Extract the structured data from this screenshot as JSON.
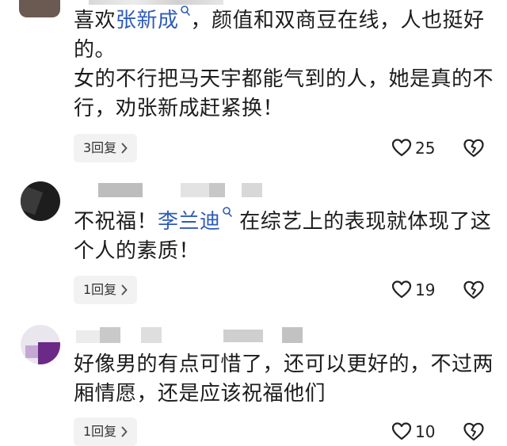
{
  "comments": [
    {
      "line1_pre": "喜欢",
      "mention": "张新成",
      "line1_post": "，颜值和双商豆在线，人也挺好",
      "line2": "的。",
      "line3": "女的不行把马天宇都能气到的人，她是真的不",
      "line4": "行，劝张新成赶紧换！",
      "reply_label": "3回复",
      "likes": "25"
    },
    {
      "line1_pre": "不祝福！",
      "mention": "李兰迪",
      "line1_post": "在综艺上的表现就体现了这",
      "line2": "个人的素质！",
      "reply_label": "1回复",
      "likes": "19"
    },
    {
      "line1": "好像男的有点可惜了，还可以更好的，不过两",
      "line2": "厢情愿，还是应该祝福他们",
      "reply_label": "1回复",
      "likes": "10"
    }
  ],
  "icons": {
    "mention": "mention-search-icon",
    "chevron": "chevron-right-icon",
    "like": "heart-icon",
    "dislike": "broken-heart-icon"
  },
  "colors": {
    "mention": "#2e5bb8",
    "text": "#1c1c1c",
    "reply_bg": "#f2f2f2"
  }
}
